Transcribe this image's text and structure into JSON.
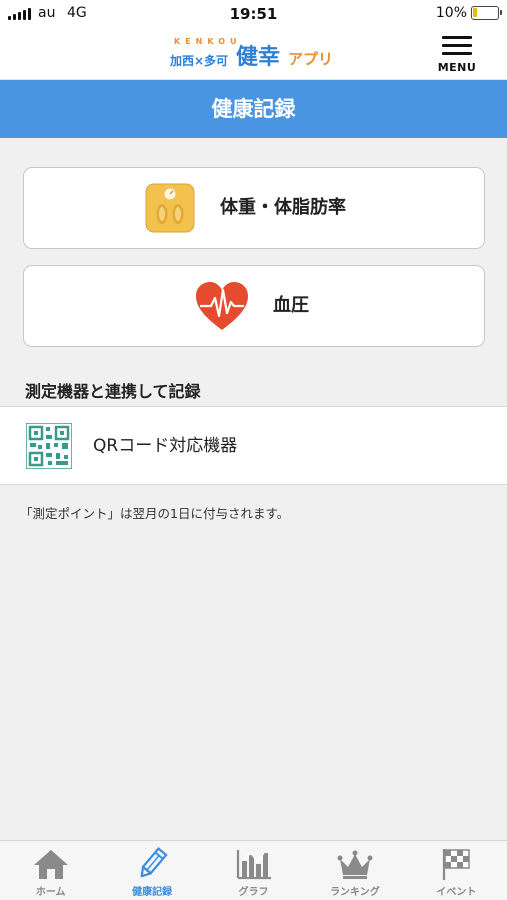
{
  "status_bar": {
    "carrier": "au",
    "network": "4G",
    "time": "19:51",
    "battery_percent": "10%",
    "battery_level": 0.1,
    "battery_color": "#e9b800"
  },
  "header": {
    "logo": {
      "kenkou": "KENKOU",
      "region": "加西×多可",
      "name": "健幸",
      "app": "アプリ"
    },
    "menu_label": "MENU",
    "menu_icon": "hamburger-icon"
  },
  "page": {
    "title": "健康記録",
    "title_bar_color": "#4a95e2"
  },
  "records": [
    {
      "label": "体重・体脂肪率",
      "icon": "scale-icon",
      "icon_color": "#f2c14e"
    },
    {
      "label": "血圧",
      "icon": "heart-pulse-icon",
      "icon_color": "#e54b2e"
    }
  ],
  "device_section": {
    "heading": "測定機器と連携して記録",
    "item_label": "QRコード対応機器",
    "item_icon": "qr-code-icon",
    "icon_color": "#3a9a8a"
  },
  "note": "「測定ポイント」は翌月の1日に付与されます。",
  "tabs": [
    {
      "label": "ホーム",
      "icon": "home-icon",
      "active": false
    },
    {
      "label": "健康記録",
      "icon": "pencil-icon",
      "active": true
    },
    {
      "label": "グラフ",
      "icon": "bar-chart-icon",
      "active": false
    },
    {
      "label": "ランキング",
      "icon": "crown-icon",
      "active": false
    },
    {
      "label": "イベント",
      "icon": "checkered-flag-icon",
      "active": false
    }
  ],
  "accent_color": "#3c8de0",
  "inactive_icon_color": "#8a8a8a"
}
